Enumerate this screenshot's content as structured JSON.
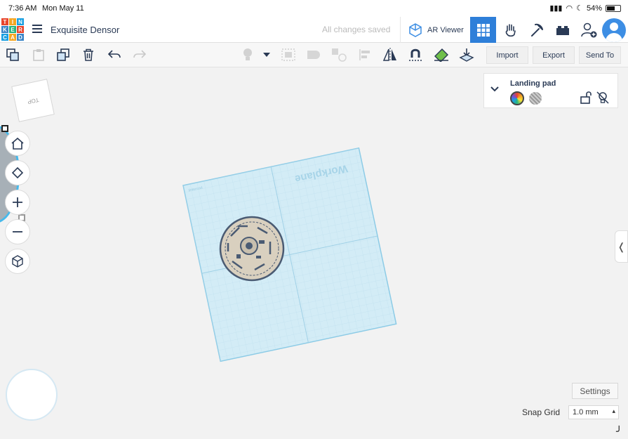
{
  "status_bar": {
    "time": "7:36 AM",
    "date": "Mon May 11",
    "battery": "54%"
  },
  "top_bar": {
    "logo_letters": [
      "T",
      "I",
      "N",
      "K",
      "E",
      "R",
      "C",
      "A",
      "D"
    ],
    "design_name": "Exquisite Densor",
    "save_status": "All changes saved",
    "ar_viewer_label": "AR Viewer",
    "icons": [
      "grid-view-icon",
      "hand-icon",
      "pickaxe-icon",
      "bricks-icon",
      "add-user-icon",
      "avatar"
    ]
  },
  "toolbar": {
    "icons": [
      "copy-icon",
      "paste-icon",
      "duplicate-icon",
      "delete-icon",
      "undo-icon",
      "redo-icon",
      "light-icon",
      "dropdown-icon",
      "group-icon",
      "union-icon",
      "ungroup-icon",
      "align-icon",
      "mirror-icon",
      "magnet-icon",
      "ruler-icon",
      "workplane-drop-icon"
    ],
    "import_label": "Import",
    "export_label": "Export",
    "send_to_label": "Send To"
  },
  "viewcube": {
    "label": "TOP"
  },
  "shape_panel": {
    "title": "Landing pad",
    "swatches": [
      "color-swatch",
      "hole-swatch"
    ]
  },
  "workplane": {
    "label": "Workplane",
    "brand": "tinkercad"
  },
  "bottom": {
    "settings_label": "Settings",
    "snap_grid_label": "Snap Grid",
    "snap_grid_value": "1.0 mm"
  },
  "colors": {
    "accent": "#2e7fd9",
    "workplane": "#d3ecf6",
    "text_dark": "#2a3a55"
  }
}
